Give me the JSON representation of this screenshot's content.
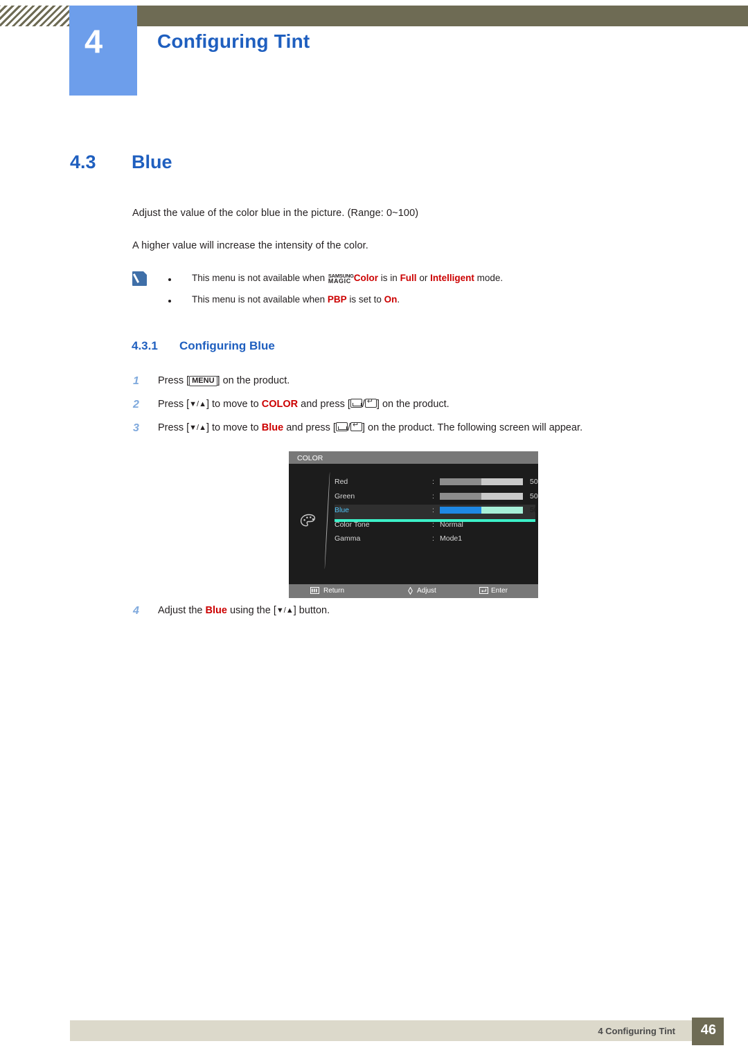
{
  "header": {
    "chapter_number": "4",
    "chapter_title": "Configuring Tint"
  },
  "section": {
    "number": "4.3",
    "title": "Blue"
  },
  "body": {
    "paragraph_1": "Adjust the value of the color blue in the picture. (Range: 0~100)",
    "paragraph_2": "A higher value will increase the intensity of the color."
  },
  "note": {
    "icon": "note-pencil-icon",
    "line1": {
      "pre": "This menu is not available when ",
      "magic_top": "SAMSUNG",
      "magic_bottom": "MAGIC",
      "color_word": "Color",
      "mid": " is in ",
      "full": "Full",
      "or": " or ",
      "intelligent": "Intelligent",
      "post": " mode."
    },
    "line2": {
      "pre": "This menu is not available when ",
      "pbp": "PBP",
      "mid": " is set to ",
      "on": "On",
      "post": "."
    }
  },
  "subsection": {
    "number": "4.3.1",
    "title": "Configuring Blue"
  },
  "steps": [
    {
      "number": "1",
      "pre": "Press [",
      "key": "MENU",
      "post": "] on the product."
    },
    {
      "number": "2",
      "pre": "Press [",
      "arrows": "▼/▲",
      "mid": "] to move to ",
      "target": "COLOR",
      "mid2": " and press [",
      "post": "] on the product."
    },
    {
      "number": "3",
      "pre": "Press [",
      "arrows": "▼/▲",
      "mid": "] to move to ",
      "target": "Blue",
      "mid2": " and press [",
      "post": "] on the product. The following screen will appear."
    },
    {
      "number": "4",
      "pre": "Adjust the ",
      "target": "Blue",
      "mid": " using the [",
      "arrows": "▼/▲",
      "post": "] button."
    }
  ],
  "osd": {
    "title": "COLOR",
    "icon": "palette-icon",
    "rows": [
      {
        "label": "Red",
        "type": "bar",
        "colon": ":",
        "value": "50",
        "fill_percent": 50
      },
      {
        "label": "Green",
        "type": "bar",
        "colon": ":",
        "value": "50",
        "fill_percent": 50
      },
      {
        "label": "Blue",
        "type": "bar",
        "colon": ":",
        "value": "50",
        "fill_percent": 50,
        "selected": true
      },
      {
        "label": "Color Tone",
        "type": "text",
        "colon": ":",
        "value": "Normal"
      },
      {
        "label": "Gamma",
        "type": "text",
        "colon": ":",
        "value": "Mode1"
      }
    ],
    "footer": {
      "return": "Return",
      "adjust": "Adjust",
      "enter": "Enter"
    }
  },
  "footer": {
    "text": "4 Configuring Tint",
    "page": "46"
  },
  "colors": {
    "accent_blue": "#1f5fbf",
    "chapter_block": "#6d9eeb",
    "header_bar": "#6e6b54",
    "footer_bar": "#dcd9cb",
    "red": "#cc0000",
    "osd_highlight": "#3cf0c8"
  }
}
